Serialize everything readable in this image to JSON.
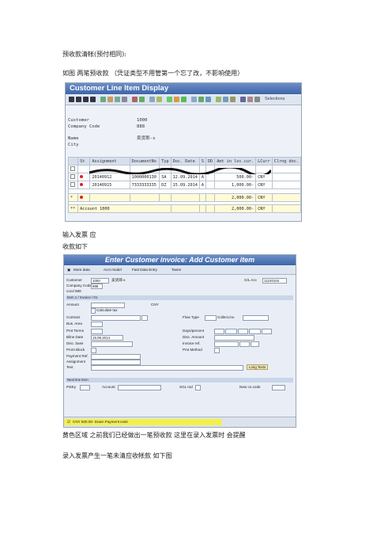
{
  "doc": {
    "heading": "预收款清帐(预付相同):",
    "line1": "如图  两笔预收款  （凭证类型不用管第一个忘了改，不影响使用）",
    "line2": "输入发票  应",
    "line3": "收款如下",
    "line4": "黄色区域  之前我们已经做出一笔预收款  这里在录入发票时  会提醒",
    "line5": "录入发票产生一笔未清应收帐款  如下图"
  },
  "shot1": {
    "title": "Customer Line Item Display",
    "selections": "Selections",
    "fields": [
      {
        "label": "Customer",
        "value": "1000"
      },
      {
        "label": "Company Code",
        "value": "888"
      },
      {
        "label": "Name",
        "value": "卖货郎-x"
      },
      {
        "label": "City",
        "value": ""
      }
    ],
    "headers": [
      "St",
      "Assignment",
      "DocumentNo",
      "Typ",
      "Doc. Date",
      "S",
      "DD",
      "Amt in loc.cur.",
      "LCurr",
      "Clrng doc."
    ],
    "rows": [
      {
        "assignment": "20140912",
        "docno": "1000000130",
        "typ": "SA",
        "date": "12.09.2014",
        "s": "A",
        "amt": "500.00-",
        "curr": "CNY"
      },
      {
        "assignment": "20140915",
        "docno": "7333333335",
        "typ": "DZ",
        "date": "15.09.2014",
        "s": "A",
        "amt": "1,000.00-",
        "curr": "CNY"
      }
    ],
    "subtotal": {
      "star": "*",
      "amt": "2,000.00-",
      "curr": "CNY"
    },
    "total": {
      "stars": "**",
      "label": "Account 1000",
      "amt": "2,000.00-",
      "curr": "CNY"
    }
  },
  "shot2": {
    "title": "Enter Customer invoice: Add Customer item",
    "toolbar": [
      "More data",
      "Acct model",
      "Fast Data Entry",
      "Taxes"
    ],
    "customer_label": "Customer",
    "customer_value": "1000",
    "customer_name": "卖货郎-x",
    "gl_label": "G/L Acc",
    "gl_value": "11220104",
    "cc_label": "Company Code",
    "cc_value": "888",
    "cc_name": "cocd 888",
    "section1": "Item 1 / Invoice / 01",
    "amount_label": "Amount",
    "amount_curr": "CNY",
    "calc_tax": "Calculate tax",
    "contract_label": "Contract",
    "flow_type": "Flow Type",
    "collect_inv": "Collect.inv.",
    "bus_area": "Bus. Area",
    "pmt_terms": "Pmt Terms",
    "days_percent": "Days/percent",
    "bline_label": "Bline Date",
    "bline_value": "15.09.2014",
    "disc_amount": "Disc. Amount",
    "disc_base": "Disc. base",
    "invoice_ref": "Invoice ref.",
    "pmnt_block": "Pmnt Block",
    "pmt_method": "Pmt Method",
    "payment_ref": "Payment Ref.",
    "assignment": "Assignment",
    "text": "Text",
    "long_texts": "Long Texts",
    "section2": "Next line item",
    "pstky": "PstKy",
    "account": "Account",
    "sgl_ind": "SGL Ind",
    "new_co_code": "New co.code",
    "status_text": "CNY          500.00- Down Payment exist"
  }
}
